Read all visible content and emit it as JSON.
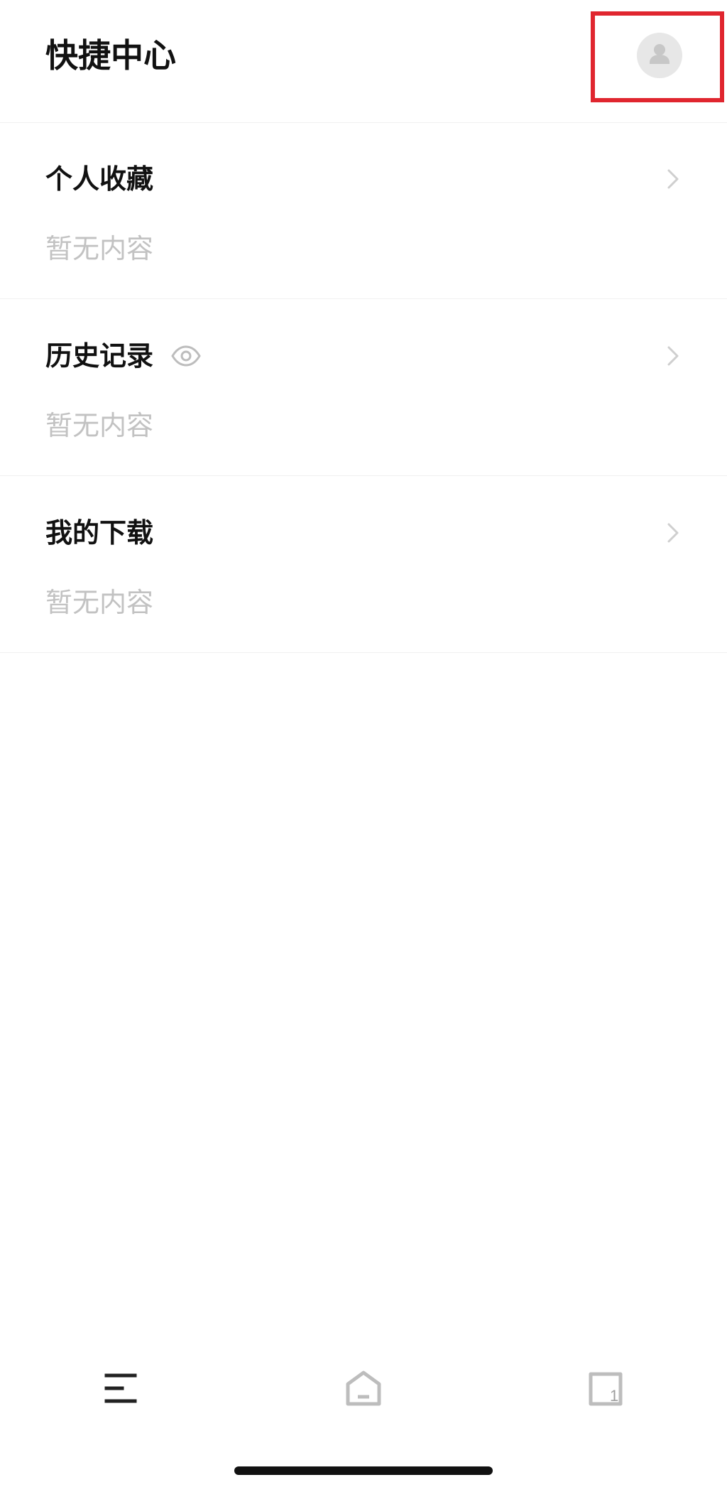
{
  "header": {
    "title": "快捷中心",
    "avatar_icon": "user-avatar-icon"
  },
  "sections": [
    {
      "title": "个人收藏",
      "empty_text": "暂无内容",
      "arrow_icon": "chevron-right-icon"
    },
    {
      "title": "历史记录",
      "empty_text": "暂无内容",
      "title_icon": "eye-icon",
      "arrow_icon": "chevron-right-icon"
    },
    {
      "title": "我的下载",
      "empty_text": "暂无内容",
      "arrow_icon": "chevron-right-icon"
    }
  ],
  "bottom_nav": {
    "items": [
      {
        "icon": "menu-icon"
      },
      {
        "icon": "home-icon"
      },
      {
        "icon": "tabs-icon",
        "badge": "1"
      }
    ]
  },
  "colors": {
    "highlight": "#e0262f",
    "title": "#111111",
    "placeholder": "#c2c2c2",
    "icon_gray": "#bdbdbd"
  }
}
